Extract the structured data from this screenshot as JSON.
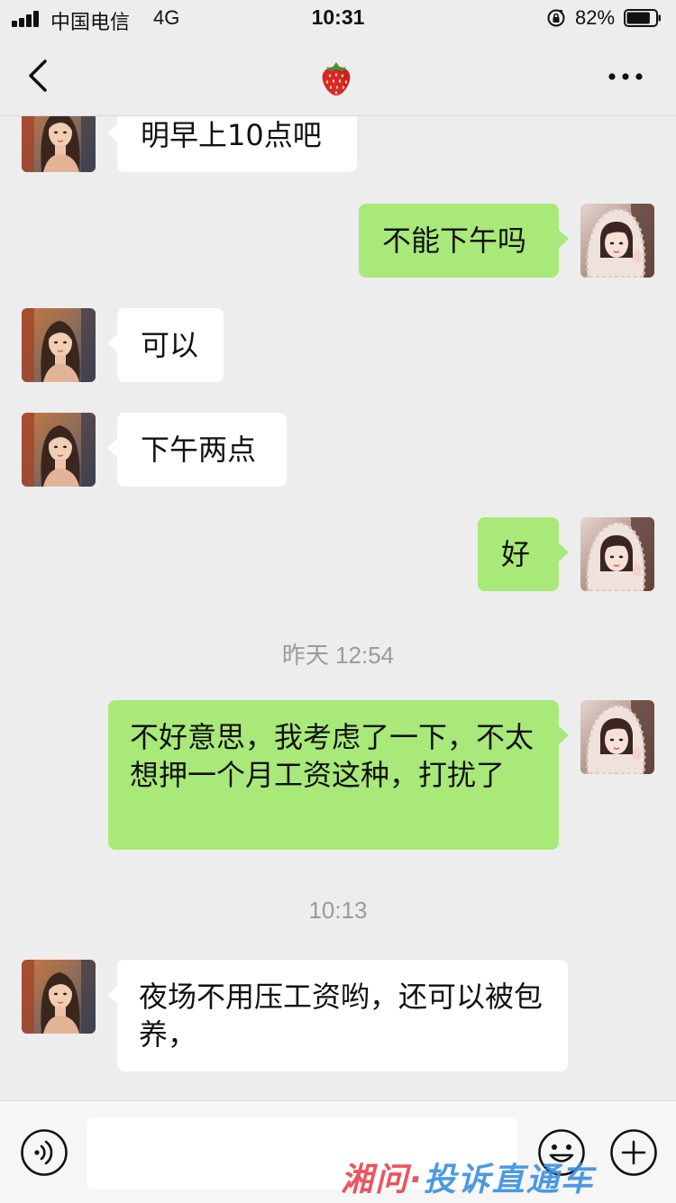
{
  "status_bar": {
    "carrier": "中国电信",
    "network": "4G",
    "time": "10:31",
    "battery_percent": "82%",
    "battery_level": 0.82
  },
  "nav": {
    "title_icon": "strawberry-icon",
    "back_icon": "chevron-left-icon",
    "more_icon": "more-dots-icon"
  },
  "messages": [
    {
      "side": "left",
      "text": "明早上10点吧"
    },
    {
      "side": "right",
      "text": "不能下午吗"
    },
    {
      "side": "left",
      "text": "可以"
    },
    {
      "side": "left",
      "text": "下午两点"
    },
    {
      "side": "right",
      "text": "好"
    },
    {
      "timestamp": "昨天 12:54"
    },
    {
      "side": "right",
      "text": "不好意思，我考虑了一下，不太想押一个月工资这种，打扰了"
    },
    {
      "timestamp": "10:13"
    },
    {
      "side": "left",
      "text": "夜场不用压工资哟，还可以被包养，"
    }
  ],
  "input_bar": {
    "voice_icon": "voice-icon",
    "emoji_icon": "emoji-icon",
    "plus_icon": "plus-icon",
    "watermark": "湘问·投诉直通车"
  },
  "colors": {
    "background": "#ededed",
    "sent_bubble": "#a9e97a",
    "received_bubble": "#ffffff",
    "timestamp": "#9b9b9b"
  }
}
